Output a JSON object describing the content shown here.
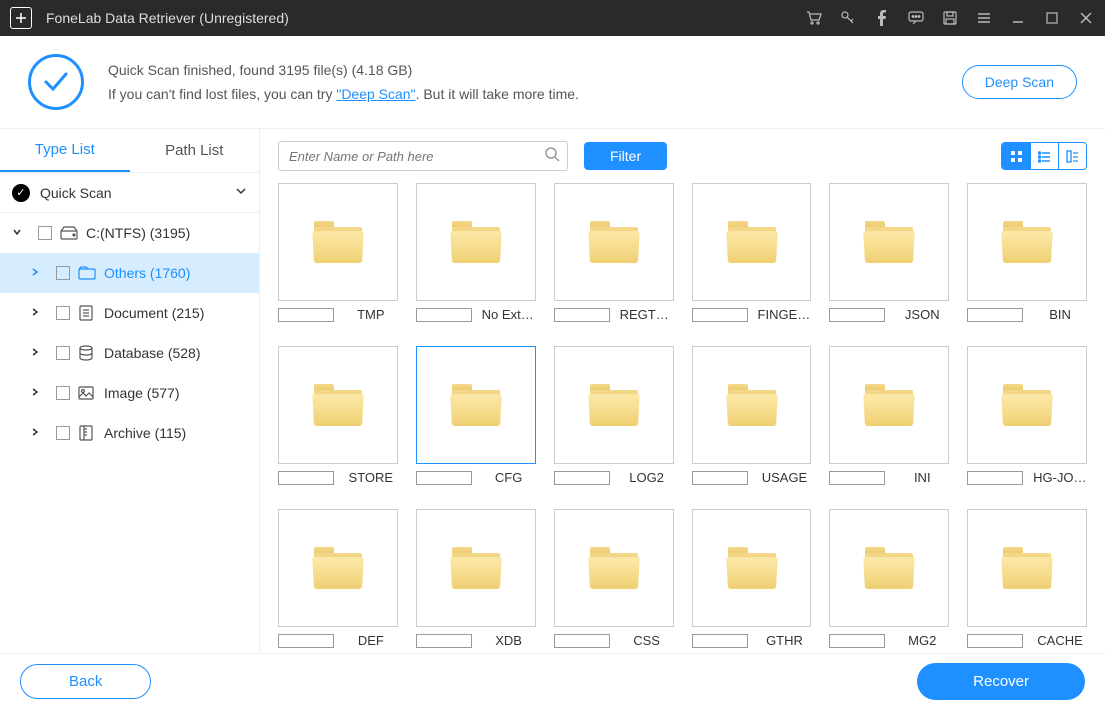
{
  "titlebar": {
    "title": "FoneLab Data Retriever (Unregistered)"
  },
  "status": {
    "line1": "Quick Scan finished, found 3195 file(s) (4.18 GB)",
    "line2_pre": "If you can't find lost files, you can try ",
    "line2_link": "\"Deep Scan\"",
    "line2_post": ". But it will take more time.",
    "deep_scan_btn": "Deep Scan"
  },
  "tabs": {
    "type_list": "Type List",
    "path_list": "Path List"
  },
  "tree": {
    "quick_scan": "Quick Scan",
    "drive": "C:(NTFS) (3195)",
    "items": [
      {
        "label": "Others (1760)",
        "selected": true
      },
      {
        "label": "Document (215)"
      },
      {
        "label": "Database (528)"
      },
      {
        "label": "Image (577)"
      },
      {
        "label": "Archive (115)"
      }
    ]
  },
  "toolbar": {
    "search_placeholder": "Enter Name or Path here",
    "filter": "Filter"
  },
  "folders": [
    {
      "name": "TMP"
    },
    {
      "name": "No Extension"
    },
    {
      "name": "REGTRANS-MS"
    },
    {
      "name": "FINGERPRINT"
    },
    {
      "name": "JSON"
    },
    {
      "name": "BIN"
    },
    {
      "name": "STORE"
    },
    {
      "name": "CFG",
      "selected": true
    },
    {
      "name": "LOG2"
    },
    {
      "name": "USAGE"
    },
    {
      "name": "INI"
    },
    {
      "name": "HG-JOURNAL"
    },
    {
      "name": "DEF"
    },
    {
      "name": "XDB"
    },
    {
      "name": "CSS"
    },
    {
      "name": "GTHR"
    },
    {
      "name": "MG2"
    },
    {
      "name": "CACHE"
    }
  ],
  "footer": {
    "back": "Back",
    "recover": "Recover"
  }
}
